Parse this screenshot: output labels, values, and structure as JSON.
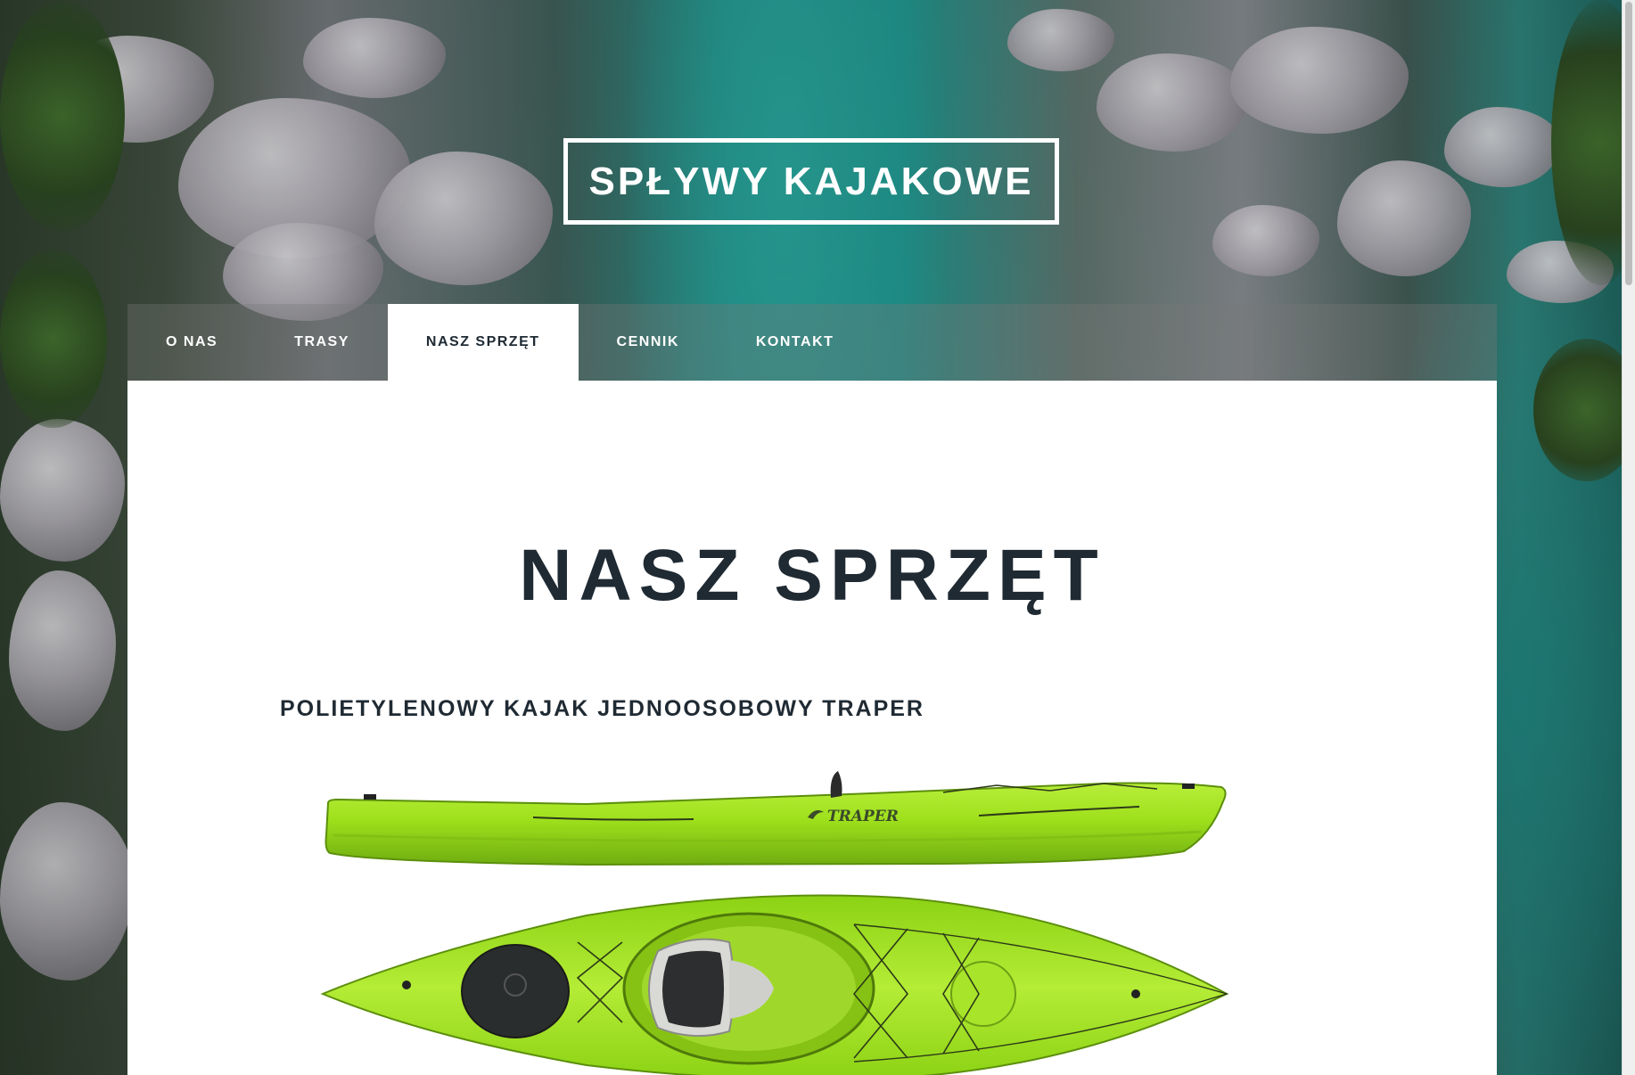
{
  "header": {
    "title": "SPŁYWY KAJAKOWE"
  },
  "nav": {
    "items": [
      {
        "label": "O NAS",
        "active": false
      },
      {
        "label": "TRASY",
        "active": false
      },
      {
        "label": "NASZ SPRZĘT",
        "active": true
      },
      {
        "label": "CENNIK",
        "active": false
      },
      {
        "label": "KONTAKT",
        "active": false
      }
    ]
  },
  "main": {
    "heading": "NASZ SPRZĘT",
    "product": {
      "title": "POLIETYLENOWY KAJAK JEDNOOSOBOWY TRAPER",
      "brand_logo_text": "TRAPER",
      "image": "green kayak, side and top view"
    }
  },
  "colors": {
    "heading_text": "#1f2a33",
    "nav_text": "#ffffff",
    "kayak_green": "#9fe01c",
    "panel_bg": "#ffffff"
  }
}
